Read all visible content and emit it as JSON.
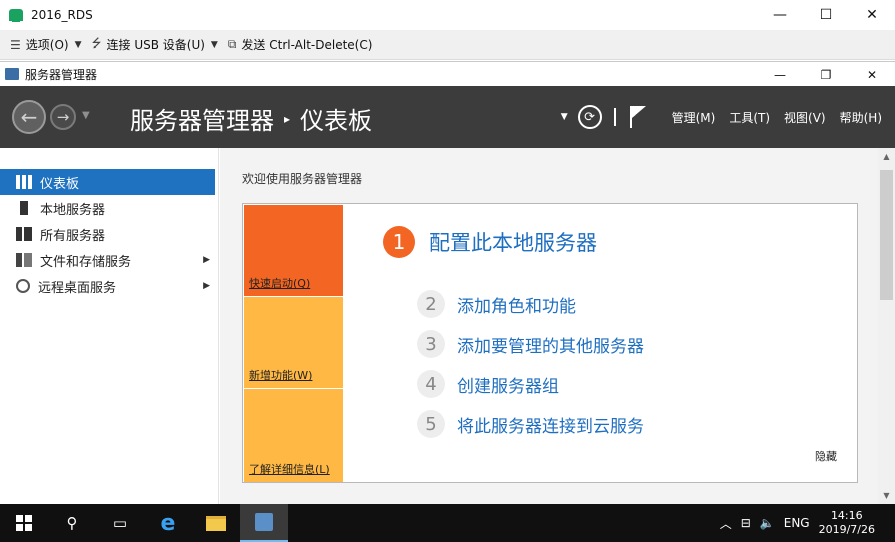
{
  "vm": {
    "title": "2016_RDS",
    "window_controls": {
      "minimize": "—",
      "maximize": "☐",
      "close": "✕"
    },
    "toolbar": {
      "options": "选项(O)",
      "usb": "连接 USB 设备(U)",
      "send": "发送 Ctrl-Alt-Delete(C)"
    }
  },
  "server_manager": {
    "window_title": "服务器管理器",
    "window_controls": {
      "minimize": "—",
      "restore": "❐",
      "close": "✕"
    },
    "header": {
      "title": "服务器管理器",
      "separator": "▸",
      "page": "仪表板",
      "menus": [
        "管理(M)",
        "工具(T)",
        "视图(V)",
        "帮助(H)"
      ]
    },
    "sidebar": {
      "items": [
        {
          "label": "仪表板",
          "icon": "dashboard-icon",
          "active": true
        },
        {
          "label": "本地服务器",
          "icon": "server-icon"
        },
        {
          "label": "所有服务器",
          "icon": "servers-icon"
        },
        {
          "label": "文件和存储服务",
          "icon": "storage-icon",
          "has_children": true
        },
        {
          "label": "远程桌面服务",
          "icon": "remote-desktop-icon",
          "has_children": true
        }
      ]
    },
    "main": {
      "welcome": "欢迎使用服务器管理器",
      "tiles": [
        "快速启动(Q)",
        "新增功能(W)",
        "了解详细信息(L)"
      ],
      "steps": [
        {
          "num": "1",
          "label": "配置此本地服务器"
        },
        {
          "num": "2",
          "label": "添加角色和功能"
        },
        {
          "num": "3",
          "label": "添加要管理的其他服务器"
        },
        {
          "num": "4",
          "label": "创建服务器组"
        },
        {
          "num": "5",
          "label": "将此服务器连接到云服务"
        }
      ],
      "hide": "隐藏"
    }
  },
  "taskbar": {
    "tray": {
      "language": "ENG",
      "time": "14:16",
      "date": "2019/7/26"
    }
  },
  "colors": {
    "header_bg": "#3c3c3c",
    "active_sidebar": "#1f72c0",
    "orange": "#f26522",
    "yellow": "#ffb843",
    "link_blue": "#1f6fc1"
  }
}
